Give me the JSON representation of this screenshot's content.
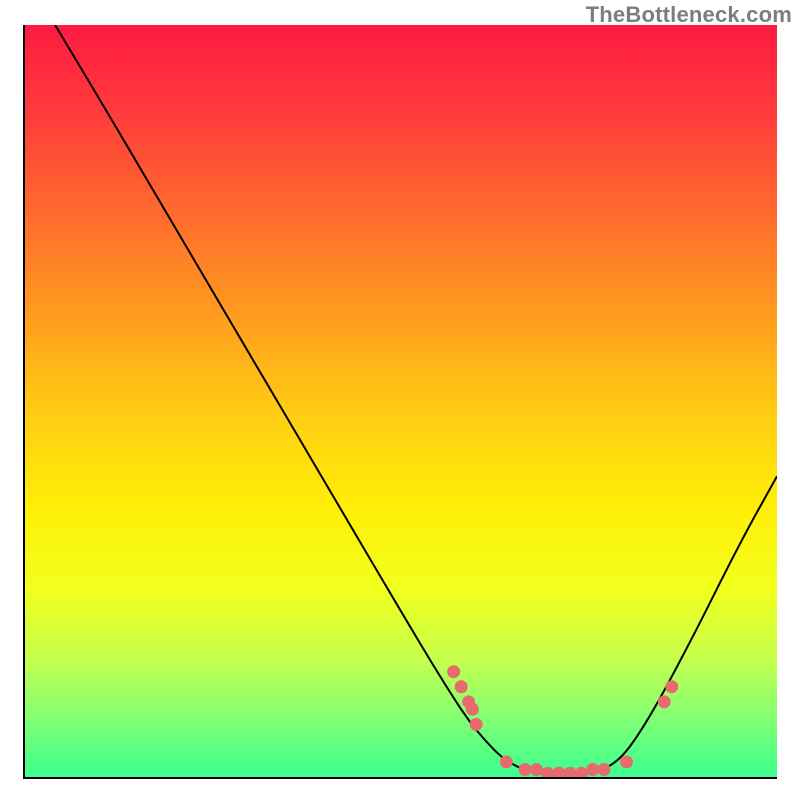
{
  "watermark": "TheBottleneck.com",
  "chart_data": {
    "type": "line",
    "title": "",
    "subtitle": "",
    "xlabel": "",
    "ylabel": "",
    "xlim": [
      0,
      100
    ],
    "ylim": [
      0,
      100
    ],
    "grid": false,
    "legend": false,
    "series": [
      {
        "name": "bottleneck-curve",
        "color": "#000000",
        "points": [
          {
            "x": 4,
            "y": 100
          },
          {
            "x": 10,
            "y": 90
          },
          {
            "x": 20,
            "y": 73
          },
          {
            "x": 30,
            "y": 56
          },
          {
            "x": 40,
            "y": 39
          },
          {
            "x": 50,
            "y": 22
          },
          {
            "x": 56,
            "y": 12
          },
          {
            "x": 60,
            "y": 6
          },
          {
            "x": 65,
            "y": 1
          },
          {
            "x": 72,
            "y": 0
          },
          {
            "x": 78,
            "y": 1
          },
          {
            "x": 82,
            "y": 6
          },
          {
            "x": 88,
            "y": 17
          },
          {
            "x": 95,
            "y": 31
          },
          {
            "x": 100,
            "y": 40
          }
        ]
      }
    ],
    "marker_series": [
      {
        "name": "highlight-dots",
        "color": "#e76b6e",
        "points": [
          {
            "x": 57,
            "y": 14
          },
          {
            "x": 58,
            "y": 12
          },
          {
            "x": 59,
            "y": 10
          },
          {
            "x": 59.5,
            "y": 9
          },
          {
            "x": 60,
            "y": 7
          },
          {
            "x": 64,
            "y": 2
          },
          {
            "x": 66.5,
            "y": 1
          },
          {
            "x": 68,
            "y": 1
          },
          {
            "x": 69.5,
            "y": 0.5
          },
          {
            "x": 71,
            "y": 0.5
          },
          {
            "x": 72.5,
            "y": 0.5
          },
          {
            "x": 74,
            "y": 0.5
          },
          {
            "x": 75.5,
            "y": 1
          },
          {
            "x": 77,
            "y": 1
          },
          {
            "x": 80,
            "y": 2
          },
          {
            "x": 85,
            "y": 10
          },
          {
            "x": 86,
            "y": 12
          }
        ]
      }
    ],
    "background_gradient": {
      "type": "vertical",
      "stops": [
        {
          "pos": 0,
          "color": "#ff1a42"
        },
        {
          "pos": 25,
          "color": "#ff6a2d"
        },
        {
          "pos": 55,
          "color": "#ffe00a"
        },
        {
          "pos": 80,
          "color": "#d9ff34"
        },
        {
          "pos": 100,
          "color": "#3bff8f"
        }
      ]
    }
  }
}
